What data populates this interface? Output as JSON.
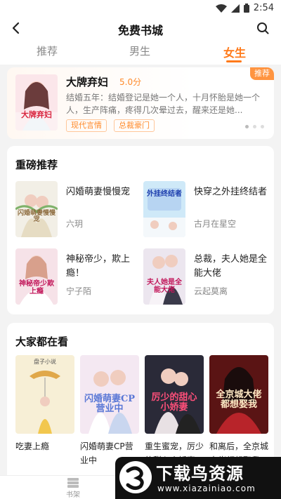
{
  "status_bar": {
    "time": "2:54"
  },
  "header": {
    "title": "免费书城"
  },
  "tabs": [
    {
      "label": "推荐",
      "active": false
    },
    {
      "label": "男生",
      "active": false
    },
    {
      "label": "女生",
      "active": true
    }
  ],
  "featured": {
    "title": "大牌弃妇",
    "score": "5.0分",
    "description": "结婚五年：结婚登记是她一个人，十月怀胎是她一个人，生产阵痛，疼得几次晕过去，醒来还是她...",
    "tags": [
      "现代言情",
      "总裁豪门"
    ],
    "badge": "推荐",
    "cover_text": "大牌弃妇"
  },
  "heavy": {
    "title": "重磅推荐",
    "books": [
      {
        "title": "闪婚萌妻慢慢宠",
        "author": "六玥",
        "cover_text": "闪婚萌妻慢慢宠"
      },
      {
        "title": "快穿之外挂终结者",
        "author": "古月在星空",
        "cover_text": "外挂终结者"
      },
      {
        "title": "神秘帝少，欺上瘾！",
        "author": "宁子陌",
        "cover_text": "神秘帝少欺上瘾"
      },
      {
        "title": "总裁，夫人她是全能大佬",
        "author": "云起莫离",
        "cover_text": "夫人她是全能大佬"
      }
    ]
  },
  "everyone": {
    "title": "大家都在看",
    "books": [
      {
        "title": "吃妻上瘾",
        "cover_text": "盘子小说"
      },
      {
        "title": "闪婚萌妻CP营业中",
        "cover_text": "闪婚萌妻CP营业中"
      },
      {
        "title": "重生蜜宠，厉少的甜心小娇妻",
        "cover_text": "厉少的甜心小娇妻"
      },
      {
        "title": "和离后，全京城大佬都想娶我",
        "cover_text": "全京城大佬都想娶我"
      }
    ]
  },
  "bottom_nav": {
    "shelf_label": "书架"
  },
  "watermark": {
    "text": "下载鸟资源",
    "url": "www.xiazainiao.com"
  },
  "colors": {
    "accent": "#ff7a1a",
    "tag": "#ff8a2a",
    "badge": "#ff9440"
  }
}
